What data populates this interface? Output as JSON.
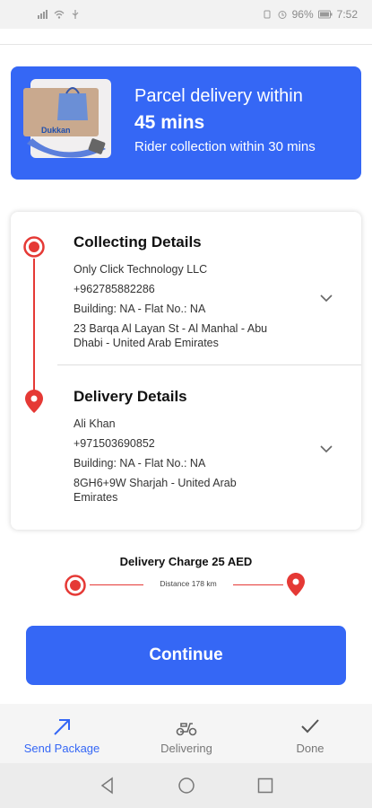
{
  "status_bar": {
    "battery": "96%",
    "time": "7:52"
  },
  "banner": {
    "line1": "Parcel delivery within",
    "line2": "45 mins",
    "line3": "Rider collection within 30 mins",
    "logo_text": "Dukkan",
    "bg_color": "#3567f5"
  },
  "collecting": {
    "title": "Collecting Details",
    "name": "Only Click Technology LLC",
    "phone": "+962785882286",
    "building": "Building: NA - Flat No.: NA",
    "address": "23 Barqa Al Layan St - Al Manhal - Abu Dhabi - United Arab Emirates"
  },
  "delivery": {
    "title": "Delivery Details",
    "name": "Ali Khan",
    "phone": "+971503690852",
    "building": "Building: NA - Flat No.: NA",
    "address": "8GH6+9W Sharjah - United Arab Emirates"
  },
  "charge": {
    "title": "Delivery Charge 25 AED",
    "distance": "Distance 178 km"
  },
  "continue_label": "Continue",
  "tabs": [
    {
      "label": "Send Package",
      "icon": "arrow-up-right-icon",
      "active": true
    },
    {
      "label": "Delivering",
      "icon": "scooter-icon",
      "active": false
    },
    {
      "label": "Done",
      "icon": "checkmark-icon",
      "active": false
    }
  ],
  "colors": {
    "accent": "#3567f5",
    "pin": "#e53935"
  }
}
